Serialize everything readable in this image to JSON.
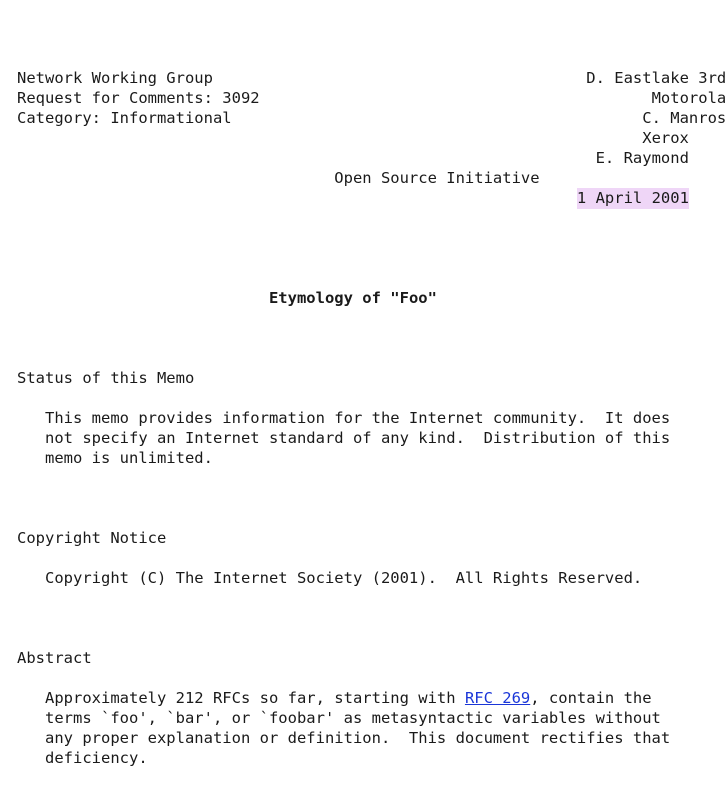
{
  "document": {
    "background_color": "#ffffff",
    "text_color": "#1a1a1a",
    "highlight_color": "#efd6f7",
    "link_color": "#1a36d8",
    "header": {
      "left_lines": [
        "Network Working Group",
        "Request for Comments: 3092",
        "Category: Informational"
      ],
      "right_lines": [
        "D. Eastlake 3rd",
        "Motorola",
        "C. Manros",
        "Xerox",
        "E. Raymond",
        "Open Source Initiative"
      ],
      "date": "1 April 2001",
      "date_highlighted": true
    },
    "title": "Etymology of \"Foo\"",
    "sections": [
      {
        "heading": "Status of this Memo",
        "body": "   This memo provides information for the Internet community.  It does\n   not specify an Internet standard of any kind.  Distribution of this\n   memo is unlimited."
      },
      {
        "heading": "Copyright Notice",
        "body": "   Copyright (C) The Internet Society (2001).  All Rights Reserved."
      },
      {
        "heading": "Abstract",
        "body_before_link": "   Approximately 212 RFCs so far, starting with ",
        "link_text": "RFC 269",
        "body_after_link": ", contain the\n   terms `foo', `bar', or `foobar' as metasyntactic variables without\n   any proper explanation or definition.  This document rectifies that\n   deficiency."
      }
    ],
    "full_header_block": "Network Working Group                                        D. Eastlake 3rd\nRequest for Comments: 3092                                           Motorola\nCategory: Informational                                             C. Manros\n                                                                        Xerox\n                                                                   E. Raymond\n                                                       Open Source Initiative"
  }
}
